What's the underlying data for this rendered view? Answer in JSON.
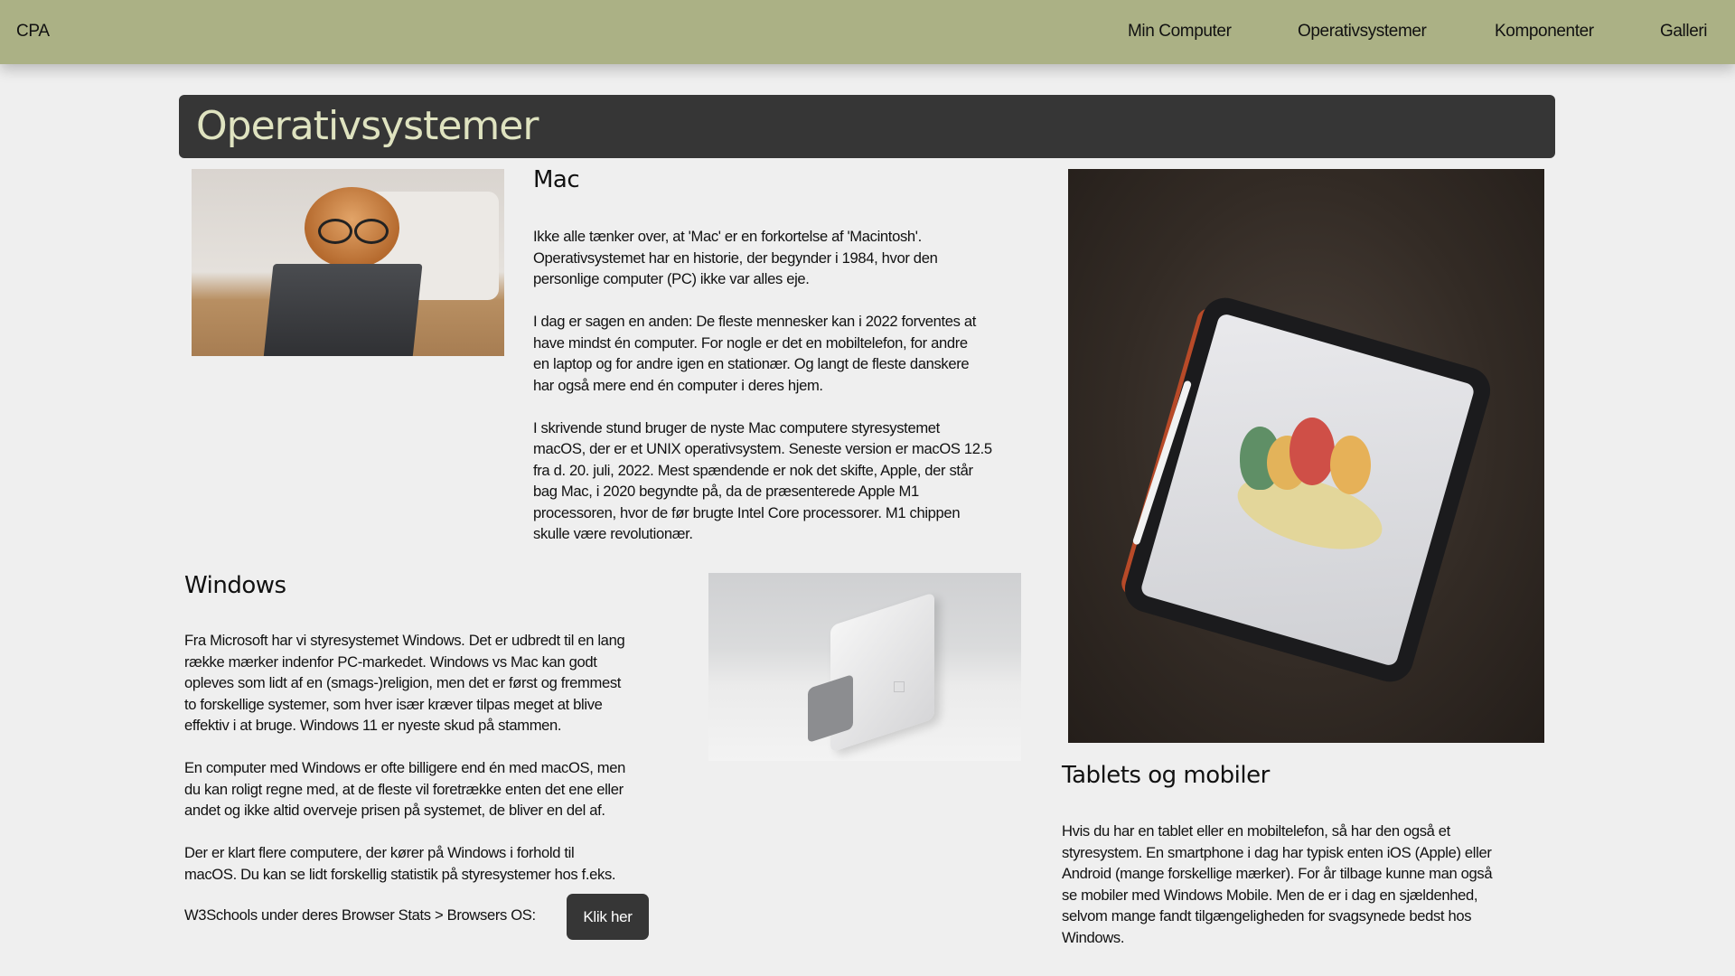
{
  "nav": {
    "brand": "CPA",
    "items": [
      "Min Computer",
      "Operativsystemer",
      "Komponenter",
      "Galleri"
    ]
  },
  "page_title": "Operativsystemer",
  "mac": {
    "heading": "Mac",
    "paragraphs": [
      [
        "Ikke alle tænker over, at 'Mac' er en forkortelse af 'Macintosh'.",
        "Operativsystemet har en historie, der begynder i 1984, hvor den",
        "personlige computer (PC) ikke var alles eje."
      ],
      [
        "I dag er sagen en anden: De fleste mennesker kan i 2022 forventes at",
        "have mindst én computer. For nogle er det en mobiltelefon, for andre",
        "en laptop og for andre igen en stationær. Og langt de fleste danskere",
        "har også mere end én computer i deres hjem."
      ],
      [
        "I skrivende stund bruger de nyste Mac computere styresystemet",
        "macOS, der er et UNIX operativsystem. Seneste version er macOS 12.5",
        "fra d. 20. juli, 2022. Mest spændende er nok det skifte, Apple, der står",
        "bag Mac, i 2020 begyndte på, da de præsenterede Apple M1",
        "processoren, hvor de før brugte Intel Core processorer. M1 chippen",
        "skulle være revolutionær."
      ]
    ]
  },
  "windows": {
    "heading": "Windows",
    "paragraphs": [
      [
        "Fra Microsoft har vi styresystemet Windows. Det er udbredt til en lang",
        "række mærker indenfor PC-markedet. Windows vs Mac kan godt",
        "opleves som lidt af en (smags-)religion, men det er først og fremmest",
        "to forskellige systemer, som hver især kræver tilpas meget at blive",
        "effektiv i at bruge. Windows 11 er nyeste skud på stammen."
      ],
      [
        "En computer med Windows er ofte billigere end én med macOS, men",
        "du kan roligt regne med, at de fleste vil foretrække enten det ene eller",
        "andet og ikke altid overveje prisen på systemet, de bliver en del af."
      ],
      [
        "Der er klart flere computere, der kører på Windows i forhold til",
        "macOS. Du kan se lidt forskellig statistik på styresystemer hos f.eks."
      ]
    ],
    "w3_text": "W3Schools under deres Browser Stats > Browsers OS:",
    "button_label": "Klik her"
  },
  "tablets": {
    "heading": "Tablets og mobiler",
    "paragraphs": [
      [
        "Hvis du har en tablet eller en mobiltelefon, så har den også et",
        "styresystem. En smartphone i dag har typisk enten iOS (Apple) eller",
        "Android (mange forskellige mærker). For år tilbage kunne man også",
        "se mobiler med Windows Mobile. Men de er i dag en sjældenhed,",
        "selvom mange fandt tilgængeligheden for svagsynede bedst hos",
        "Windows."
      ]
    ]
  },
  "colors": {
    "nav_bg": "#abb185",
    "title_bg": "#363636",
    "title_text": "#dfe3c0",
    "button_bg": "#363636"
  }
}
